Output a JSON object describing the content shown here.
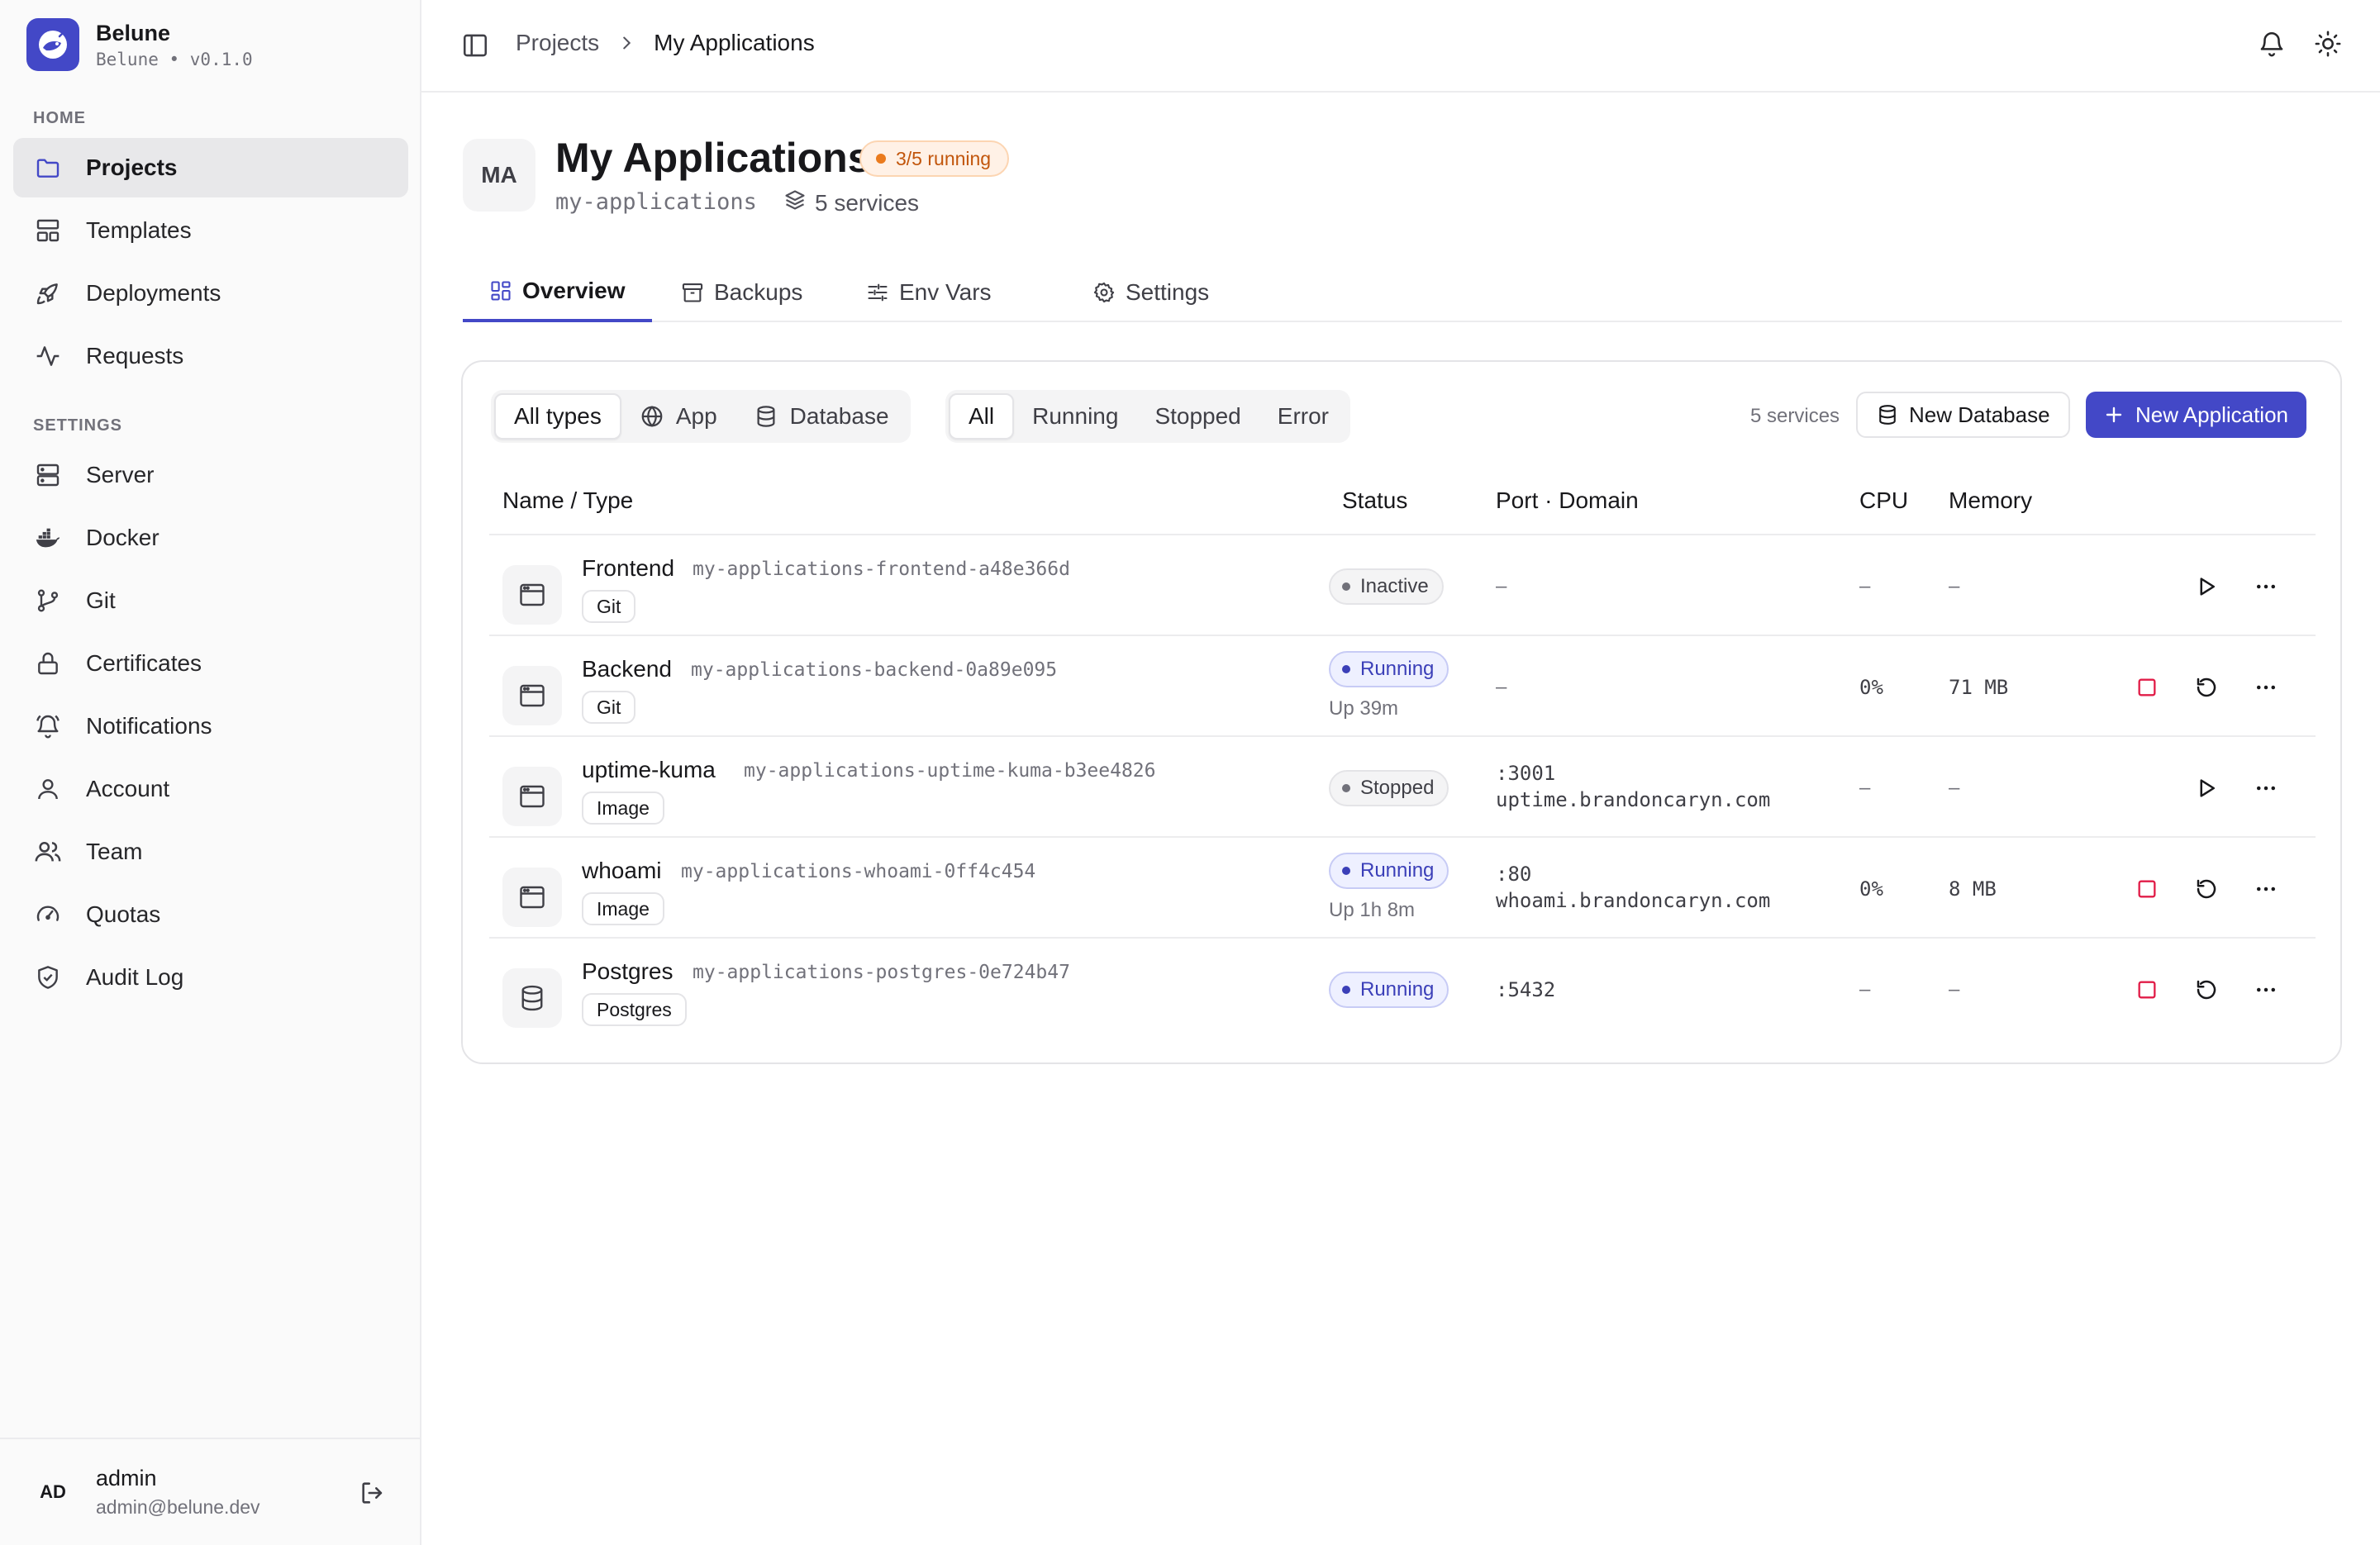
{
  "app": {
    "name": "Belune",
    "subtitle": "Belune • v0.1.0"
  },
  "sidebar": {
    "home_label": "HOME",
    "settings_label": "SETTINGS",
    "home_items": [
      {
        "label": "Projects",
        "icon": "folder-icon",
        "active": true
      },
      {
        "label": "Templates",
        "icon": "layout-icon"
      },
      {
        "label": "Deployments",
        "icon": "rocket-icon"
      },
      {
        "label": "Requests",
        "icon": "activity-icon"
      }
    ],
    "settings_items": [
      {
        "label": "Server",
        "icon": "server-icon"
      },
      {
        "label": "Docker",
        "icon": "docker-icon"
      },
      {
        "label": "Git",
        "icon": "git-branch-icon"
      },
      {
        "label": "Certificates",
        "icon": "lock-icon"
      },
      {
        "label": "Notifications",
        "icon": "bell-ring-icon"
      },
      {
        "label": "Account",
        "icon": "user-icon"
      },
      {
        "label": "Team",
        "icon": "users-icon"
      },
      {
        "label": "Quotas",
        "icon": "gauge-icon"
      },
      {
        "label": "Audit Log",
        "icon": "shield-check-icon"
      }
    ],
    "user": {
      "initials": "AD",
      "name": "admin",
      "email": "admin@belune.dev"
    }
  },
  "header": {
    "breadcrumb": [
      "Projects",
      "My Applications"
    ]
  },
  "project": {
    "initials": "MA",
    "title": "My Applications",
    "running_badge": "3/5 running",
    "slug": "my-applications",
    "services_count": "5 services"
  },
  "tabs": [
    {
      "label": "Overview",
      "icon": "grid-icon",
      "active": true
    },
    {
      "label": "Backups",
      "icon": "archive-icon"
    },
    {
      "label": "Env Vars",
      "icon": "sliders-icon"
    },
    {
      "label": "Settings",
      "icon": "gear-icon"
    }
  ],
  "filters": {
    "types": [
      "All types",
      "App",
      "Database"
    ],
    "statuses": [
      "All",
      "Running",
      "Stopped",
      "Error"
    ],
    "active_type": "All types",
    "active_status": "All"
  },
  "toolbar": {
    "service_count": "5 services",
    "new_database": "New Database",
    "new_application": "New Application"
  },
  "table": {
    "columns": [
      "Name / Type",
      "Status",
      "Port · Domain",
      "CPU",
      "Memory"
    ],
    "rows": [
      {
        "name": "Frontend",
        "id": "my-applications-frontend-a48e366d",
        "type": "Git",
        "kind": "app",
        "status": "Inactive",
        "uptime": "",
        "port": "–",
        "domain": "",
        "cpu": "–",
        "memory": "–"
      },
      {
        "name": "Backend",
        "id": "my-applications-backend-0a89e095",
        "type": "Git",
        "kind": "app",
        "status": "Running",
        "uptime": "Up 39m",
        "port": "–",
        "domain": "",
        "cpu": "0%",
        "memory": "71 MB"
      },
      {
        "name": "uptime-kuma",
        "id": "my-applications-uptime-kuma-b3ee4826",
        "type": "Image",
        "kind": "app",
        "status": "Stopped",
        "uptime": "",
        "port": ":3001",
        "domain": "uptime.brandoncaryn.com",
        "cpu": "–",
        "memory": "–"
      },
      {
        "name": "whoami",
        "id": "my-applications-whoami-0ff4c454",
        "type": "Image",
        "kind": "app",
        "status": "Running",
        "uptime": "Up 1h 8m",
        "port": ":80",
        "domain": "whoami.brandoncaryn.com",
        "cpu": "0%",
        "memory": "8 MB"
      },
      {
        "name": "Postgres",
        "id": "my-applications-postgres-0e724b47",
        "type": "Postgres",
        "kind": "database",
        "status": "Running",
        "uptime": "",
        "port": ":5432",
        "domain": "",
        "cpu": "–",
        "memory": "–"
      }
    ]
  },
  "colors": {
    "accent": "#4348c7",
    "running": "#3b3fb8",
    "warning": "#ea7b1e",
    "stop": "#e11d48"
  }
}
